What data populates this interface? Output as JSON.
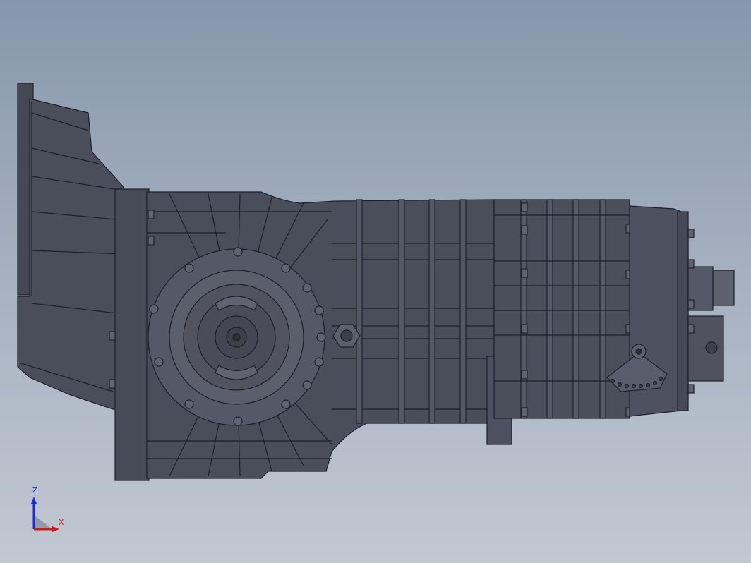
{
  "viewport": {
    "background_top": "#8797ab",
    "background_bottom": "#c2c8d2",
    "model_color": "#4a4d5a",
    "edge_color": "#1e2028"
  },
  "triad": {
    "z_label": "Z",
    "x_label": "X",
    "z_color": "#1a2bd6",
    "x_color": "#d11a1a"
  }
}
